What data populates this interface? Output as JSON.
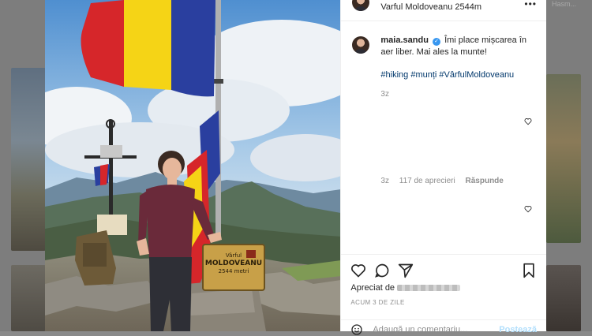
{
  "background": {
    "top_text": "Hasm..."
  },
  "post": {
    "location": "Varful Moldoveanu 2544m",
    "username": "maia.sandu",
    "caption_text": "Îmi place mișcarea în aer liber. Mai ales la munte!",
    "hashtags": "#hiking #munți #VârfulMoldoveanu",
    "caption_age": "3z",
    "comment_age": "3z",
    "comment_likes": "117 de aprecieri",
    "reply_label": "Răspunde",
    "liked_by_prefix": "Apreciat de",
    "posted_ago": "ACUM 3 DE ZILE",
    "comment_placeholder": "Adaugă un comentariu...",
    "post_button": "Postează"
  },
  "photo": {
    "sign_line1": "Vârful",
    "sign_line2": "MOLDOVEANU",
    "sign_line3": "2544 metri"
  },
  "colors": {
    "flag_blue": "#2a3f9f",
    "flag_yellow": "#f5d416",
    "flag_red": "#d6262a",
    "link_blue": "#00376b",
    "verified_blue": "#3897f0"
  }
}
